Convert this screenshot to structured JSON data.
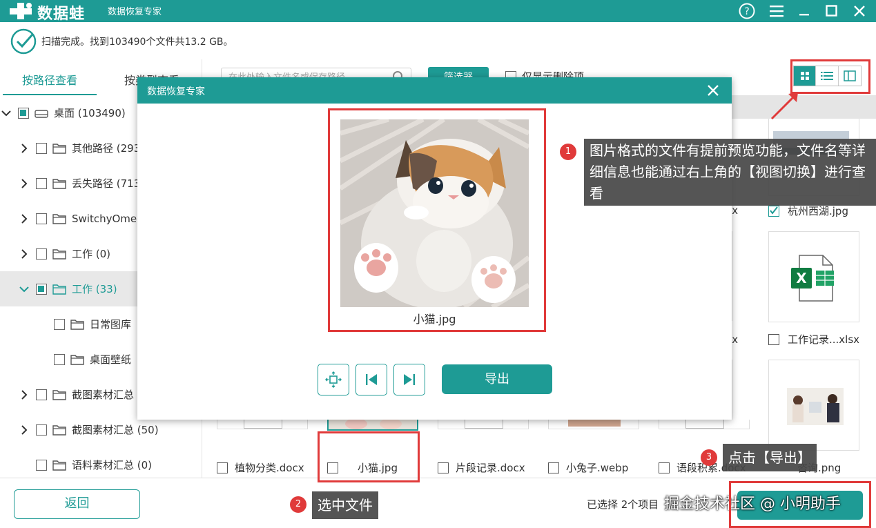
{
  "app": {
    "brand": "数据蛙",
    "title": "数据恢复专家"
  },
  "scan": {
    "status": "扫描完成。找到103490个文件共13.2 GB。"
  },
  "tabs": {
    "by_path": "按路径查看",
    "by_type": "按类型查看"
  },
  "tree": [
    {
      "label": "桌面 (103490)",
      "level": 0,
      "expanded": true,
      "checked": "partial"
    },
    {
      "label": "其他路径 (293",
      "level": 1,
      "expanded": false,
      "checked": "none"
    },
    {
      "label": "丢失路径 (713",
      "level": 1,
      "expanded": false,
      "checked": "none"
    },
    {
      "label": "SwitchyOmeg",
      "level": 1,
      "expanded": false,
      "checked": "none"
    },
    {
      "label": "工作 (0)",
      "level": 1,
      "expanded": false,
      "checked": "none"
    },
    {
      "label": "工作 (33)",
      "level": 1,
      "expanded": true,
      "checked": "partial",
      "selected": true
    },
    {
      "label": "日常图库",
      "level": 2,
      "expanded": null,
      "checked": "none"
    },
    {
      "label": "桌面壁纸",
      "level": 2,
      "expanded": null,
      "checked": "none"
    },
    {
      "label": "截图素材汇总",
      "level": 1,
      "expanded": false,
      "checked": "none"
    },
    {
      "label": "截图素材汇总 (50)",
      "level": 1,
      "expanded": false,
      "checked": "none"
    },
    {
      "label": "语料素材汇总 (0)",
      "level": 1,
      "expanded": null,
      "checked": "none"
    }
  ],
  "toolbar": {
    "search_placeholder": "在此处输入文件名或保存路径",
    "filter_label": "筛选器",
    "only_deleted_label": "仅显示删除项"
  },
  "files_visible": [
    {
      "name": "植物分类.docx",
      "checked": false
    },
    {
      "name": "小猫.jpg",
      "checked": false
    },
    {
      "name": "片段记录.docx",
      "checked": false
    },
    {
      "name": "小兔子.webp",
      "checked": false
    },
    {
      "name": "语段积累.docx",
      "checked": false
    },
    {
      "name": "咨询.png",
      "checked": false
    }
  ],
  "files_right": [
    {
      "name": "杭州西湖.jpg",
      "checked": true
    },
    {
      "name": "工作记录...xlsx",
      "checked": false
    }
  ],
  "partial_labels": {
    "a": "cx",
    "b": "cx"
  },
  "footer": {
    "back_label": "返回",
    "selected_info": "已选择 2个项目",
    "watermark": "掘金技术社区 @ 小明助手"
  },
  "modal": {
    "title": "数据恢复专家",
    "preview_name": "小猫.jpg",
    "export_label": "导出"
  },
  "annotations": {
    "n1": "1",
    "n2": "2",
    "n3": "3",
    "callout1": "图片格式的文件有提前预览功能，文件名等详细信息也能通过右上角的【视图切换】进行查看",
    "callout2": "选中文件",
    "callout3": "点击【导出】"
  },
  "colors": {
    "accent": "#1e9b95",
    "annotation_red": "#e03a3a"
  }
}
